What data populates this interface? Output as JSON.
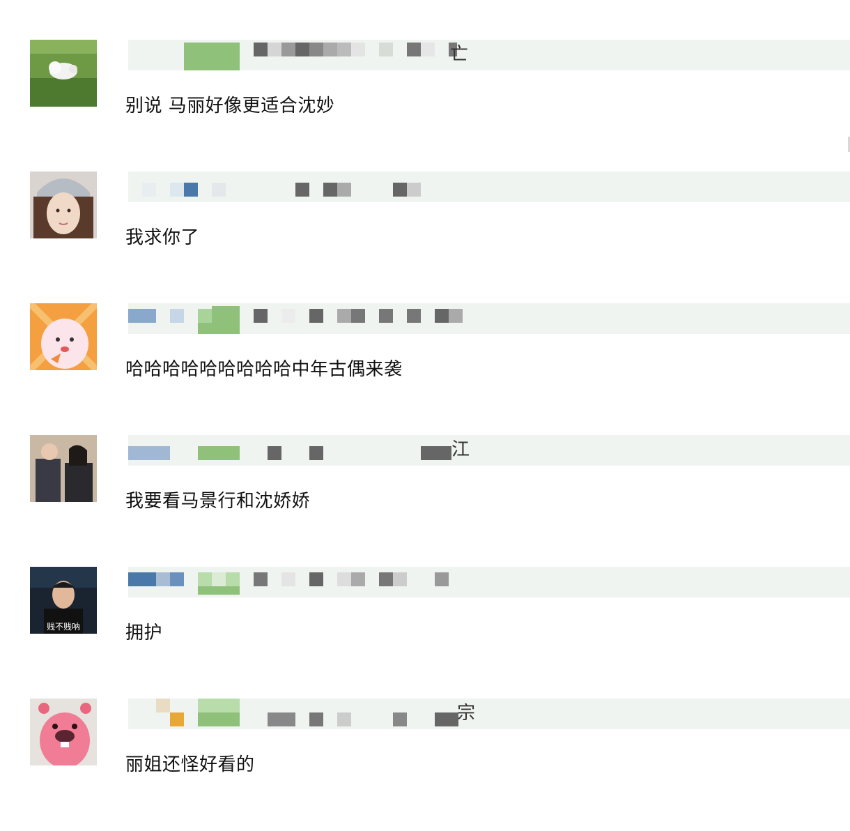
{
  "comments": [
    {
      "text": "别说 马丽好像更适合沈妙",
      "name_tail": "亡"
    },
    {
      "text": "我求你了",
      "name_tail": ""
    },
    {
      "text": "哈哈哈哈哈哈哈哈哈中年古偶来袭",
      "name_tail": ""
    },
    {
      "text": "我要看马景行和沈娇娇",
      "name_tail": "江"
    },
    {
      "text": "拥护",
      "name_tail": "",
      "avatar_caption": "贱不贱呐"
    },
    {
      "text": "丽姐还怪好看的",
      "name_tail": "宗"
    }
  ],
  "colors": {
    "name_bar_bg": "#f0f4f1",
    "green_block": "#8fc17a",
    "blue_block": "#4a78aa",
    "gray_block": "#6a6a6a"
  }
}
